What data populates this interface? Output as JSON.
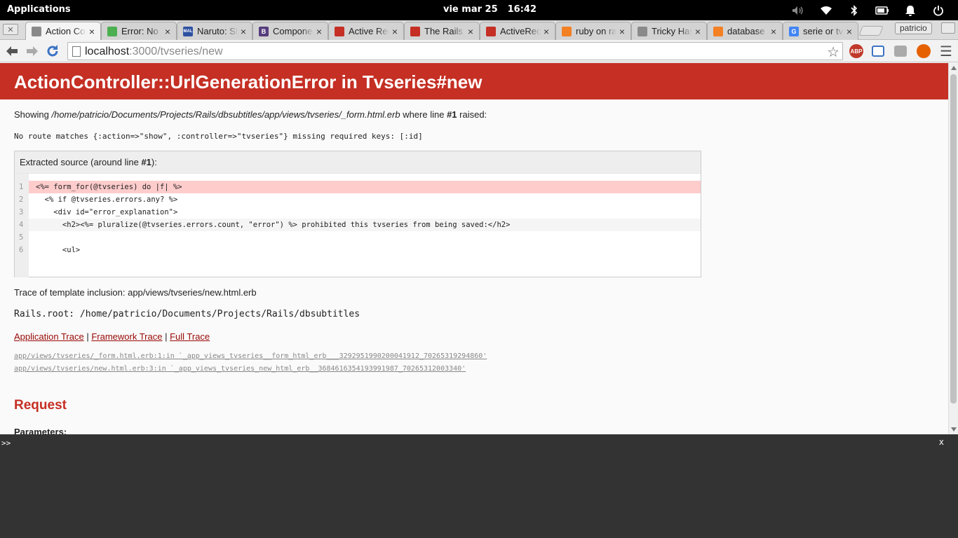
{
  "system_bar": {
    "applications": "Applications",
    "date": "vie mar 25",
    "time": "16:42"
  },
  "tabs": [
    {
      "label": "Action Con",
      "icon": "page-icon",
      "color": "#8a8a8a",
      "active": true
    },
    {
      "label": "Error: No",
      "icon": "error-favicon",
      "color": "#4caf50"
    },
    {
      "label": "Naruto: Sh",
      "icon": "mal-favicon",
      "color": "#2e51a2",
      "glyph": "MAL"
    },
    {
      "label": "Componen",
      "icon": "bootstrap-favicon",
      "color": "#563d7c",
      "glyph": "B"
    },
    {
      "label": "Active Rec",
      "icon": "rails-favicon",
      "color": "#c52f24"
    },
    {
      "label": "The Rails G",
      "icon": "rails-favicon",
      "color": "#c52f24"
    },
    {
      "label": "ActiveReco",
      "icon": "rails-favicon",
      "color": "#c52f24"
    },
    {
      "label": "ruby on ra",
      "icon": "stackoverflow-favicon",
      "color": "#f48024"
    },
    {
      "label": "Tricky Has",
      "icon": "page-icon",
      "color": "#8a8a8a"
    },
    {
      "label": "database -",
      "icon": "stackoverflow-favicon",
      "color": "#f48024"
    },
    {
      "label": "serie or tv",
      "icon": "google-favicon",
      "color": "#4285f4",
      "glyph": "G"
    }
  ],
  "profile_name": "patricio",
  "address_bar": {
    "host": "localhost",
    "path": ":3000/tvseries/new"
  },
  "error": {
    "title": "ActionController::UrlGenerationError in Tvseries#new",
    "showing_prefix": "Showing ",
    "showing_path": "/home/patricio/Documents/Projects/Rails/dbsubtitles/app/views/tvseries/_form.html.erb",
    "showing_mid": " where line ",
    "showing_line": "#1",
    "showing_suffix": " raised:",
    "message": "No route matches {:action=>\"show\", :controller=>\"tvseries\"} missing required keys: [:id]"
  },
  "source": {
    "heading_prefix": "Extracted source (around line ",
    "heading_line": "#1",
    "heading_suffix": "):",
    "lines": [
      {
        "n": "1",
        "code": "<%= form_for(@tvseries) do |f| %>"
      },
      {
        "n": "2",
        "code": "  <% if @tvseries.errors.any? %>"
      },
      {
        "n": "3",
        "code": "    <div id=\"error_explanation\">"
      },
      {
        "n": "4",
        "code": "      <h2><%= pluralize(@tvseries.errors.count, \"error\") %> prohibited this tvseries from being saved:</h2>"
      },
      {
        "n": "5",
        "code": ""
      },
      {
        "n": "6",
        "code": "      <ul>"
      }
    ]
  },
  "trace_inclusion": "Trace of template inclusion: app/views/tvseries/new.html.erb",
  "rails_root": "Rails.root: /home/patricio/Documents/Projects/Rails/dbsubtitles",
  "trace_links": {
    "application": "Application Trace",
    "framework": "Framework Trace",
    "full": "Full Trace",
    "sep": " | "
  },
  "trace_lines": [
    "app/views/tvseries/_form.html.erb:1:in `_app_views_tvseries__form_html_erb___3292951990200041912_70265319294860'",
    "app/views/tvseries/new.html.erb:3:in `_app_views_tvseries_new_html_erb__3684616354193991987_70265312003340'"
  ],
  "request": {
    "title": "Request",
    "parameters_label": "Parameters"
  },
  "console": {
    "prompt": ">>",
    "close": "x"
  }
}
